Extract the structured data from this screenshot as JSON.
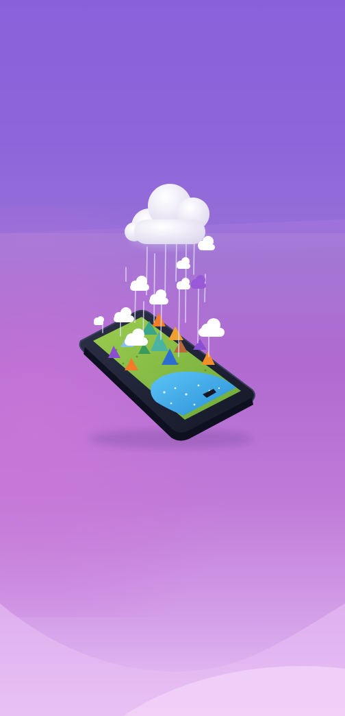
{
  "scene": {
    "colors": {
      "sky_top": "#8a5fda",
      "sky_mid": "#b06ad0",
      "sky_bottom": "#ecc8f6",
      "phone_body": "#1e2236",
      "screen_grass": "#8cc24a",
      "screen_water": "#3aa9e8",
      "cloud": "#ffffff",
      "tree_orange": "#f07c2a",
      "tree_teal": "#3aa58a",
      "tree_purple": "#8a4fd0",
      "tree_blue": "#2a6fd0"
    },
    "icons": {
      "main_cloud": "cloud-icon",
      "small_cloud": "cloud-icon",
      "tree": "tree-icon",
      "phone": "smartphone-icon"
    }
  }
}
